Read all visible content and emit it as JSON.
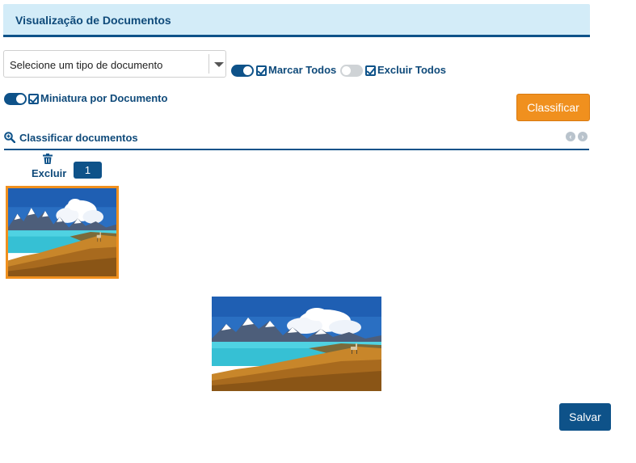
{
  "header": {
    "title": "Visualização de Documentos"
  },
  "document_type_select": {
    "selected": "Selecione um tipo de documento"
  },
  "options": {
    "mark_all": {
      "label": "Marcar Todos",
      "toggle_on": true,
      "checked": true
    },
    "delete_all": {
      "label": "Excluir Todos",
      "toggle_on": false,
      "checked": true
    },
    "thumbnail_per_document": {
      "label": "Miniatura por Documento",
      "toggle_on": true,
      "checked": true
    }
  },
  "classify_button": {
    "label": "Classificar"
  },
  "section": {
    "title": "Classificar documentos",
    "icons": {
      "search": "zoom-in-icon",
      "prev": "chevron-left-icon",
      "next": "chevron-right-icon"
    }
  },
  "document": {
    "delete_label": "Excluir",
    "delete_icon": "trash-icon",
    "page_number": "1"
  },
  "save_button": {
    "label": "Salvar"
  },
  "colors": {
    "primary": "#0e5289",
    "accent": "#f0901e",
    "header_bg": "#d3ecf8"
  }
}
